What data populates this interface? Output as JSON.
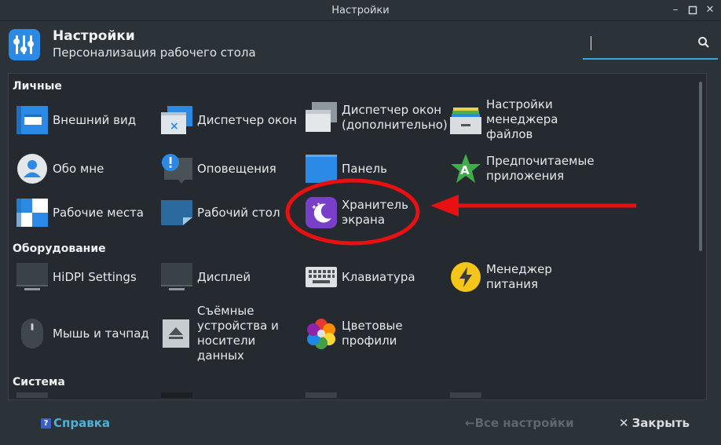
{
  "window": {
    "title": "Настройки"
  },
  "header": {
    "title": "Настройки",
    "subtitle": "Персонализация рабочего стола"
  },
  "search": {
    "placeholder": "",
    "value": ""
  },
  "sections": {
    "personal": "Личные",
    "hardware": "Оборудование",
    "system": "Система"
  },
  "items": {
    "appearance": "Внешний вид",
    "window_manager": "Диспетчер окон",
    "window_manager_tweaks": "Диспетчер окон\n(дополнительно)",
    "file_manager": "Настройки\nменеджера\nфайлов",
    "about_me": "Обо мне",
    "notifications": "Оповещения",
    "panel": "Панель",
    "preferred_apps": "Предпочитаемые\nприложения",
    "workspaces": "Рабочие места",
    "desktop": "Рабочий стол",
    "screensaver": "Хранитель\nэкрана",
    "hidpi": "HiDPI Settings",
    "display": "Дисплей",
    "keyboard": "Клавиатура",
    "power_manager": "Менеджер\nпитания",
    "mouse": "Мышь и тачпад",
    "removable": "Съёмные\nустройства и\nносители\nданных",
    "color_profiles": "Цветовые\nпрофили"
  },
  "footer": {
    "help": "Справка",
    "all_settings": "Все настройки",
    "close": "Закрыть"
  },
  "colors": {
    "accent": "#3aa7d8",
    "annotation_red": "#e81010",
    "help_text": "#4fb0d8"
  }
}
